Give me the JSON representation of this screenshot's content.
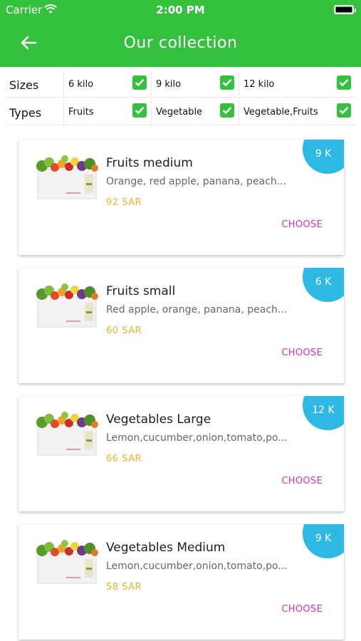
{
  "status_bar": {
    "carrier": "Carrier",
    "time": "2:00 PM"
  },
  "header": {
    "title": "Our collection"
  },
  "filters": {
    "sizes": {
      "label": "Sizes",
      "options": [
        {
          "label": "6 kilo",
          "checked": true
        },
        {
          "label": "9 kilo",
          "checked": true
        },
        {
          "label": "12 kilo",
          "checked": true
        }
      ]
    },
    "types": {
      "label": "Types",
      "options": [
        {
          "label": "Fruits",
          "checked": true
        },
        {
          "label": "Vegetable",
          "checked": true
        },
        {
          "label": "Vegetable,Fruits",
          "checked": true
        }
      ]
    }
  },
  "products": [
    {
      "name": "Fruits medium",
      "description": "Orange, red apple, panana, peaches",
      "price": "92 SAR",
      "size_badge": "9 K",
      "action": "CHOOSE"
    },
    {
      "name": "Fruits small",
      "description": "Red apple, orange, panana, peaches",
      "price": "60 SAR",
      "size_badge": "6 K",
      "action": "CHOOSE"
    },
    {
      "name": "Vegetables Large",
      "description": "Lemon,cucumber,onion,tomato,potato",
      "price": "66 SAR",
      "size_badge": "12 K",
      "action": "CHOOSE"
    },
    {
      "name": "Vegetables Medium",
      "description": "Lemon,cucumber,onion,tomato,potato",
      "price": "58 SAR",
      "size_badge": "9 K",
      "action": "CHOOSE"
    }
  ],
  "colors": {
    "header_green": "#33c13e",
    "checkbox_green": "#33c13e",
    "badge_blue": "#2db9e4",
    "price_orange": "#f1b22d",
    "choose_pink": "#e02fa8"
  },
  "icons": {
    "back": "arrow-left-icon",
    "wifi": "wifi-icon",
    "battery": "battery-icon",
    "checkbox": "checkmark-icon",
    "product_image": "vegetable-box-icon"
  }
}
